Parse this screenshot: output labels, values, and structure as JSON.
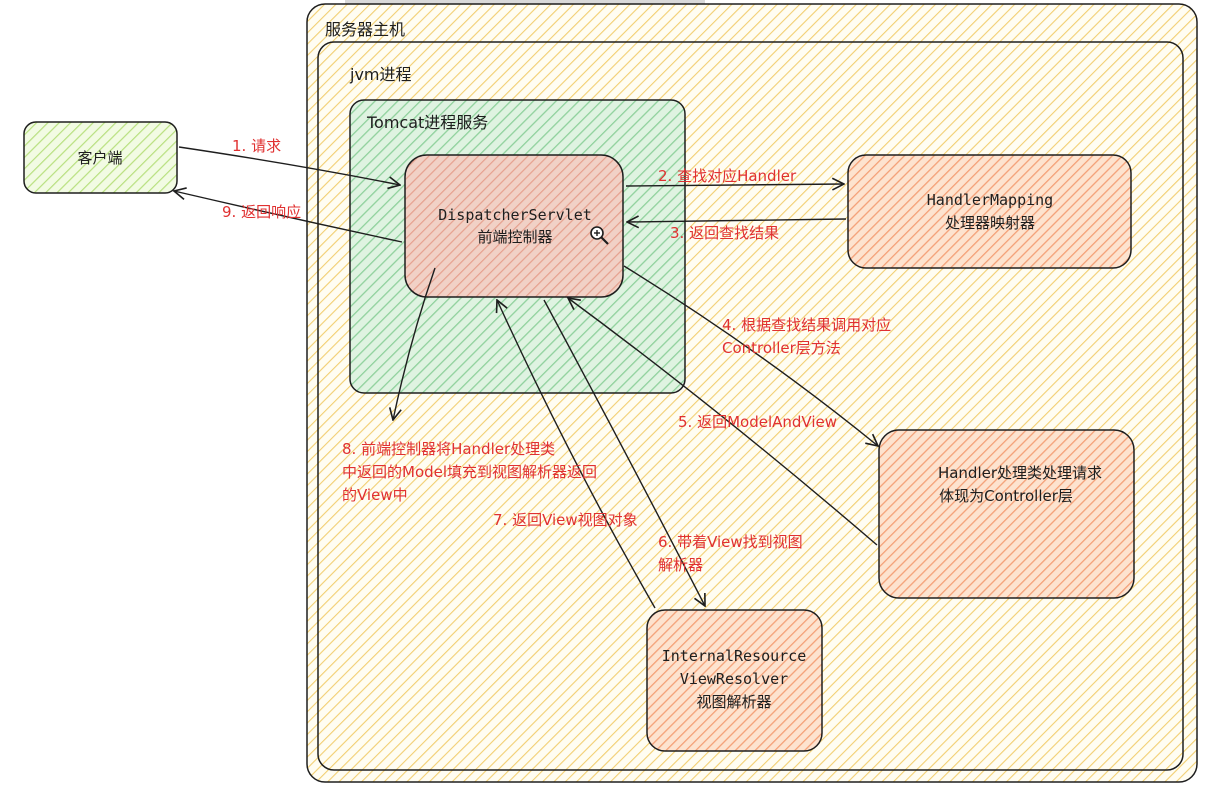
{
  "containers": {
    "server_host": "服务器主机",
    "jvm_process": "jvm进程",
    "tomcat_service": "Tomcat进程服务"
  },
  "nodes": {
    "client": "客户端",
    "dispatcher_line1": "DispatcherServlet",
    "dispatcher_line2": "前端控制器",
    "handler_mapping_line1": "HandlerMapping",
    "handler_mapping_line2": "处理器映射器",
    "handler_line1": "Handler处理类处理请求",
    "handler_line2": "体现为Controller层",
    "view_resolver_line1": "InternalResource",
    "view_resolver_line2": "ViewResolver",
    "view_resolver_line3": "视图解析器"
  },
  "steps": {
    "s1": "1. 请求",
    "s2": "2. 查找对应Handler",
    "s3": "3. 返回查找结果",
    "s4_line1": "4. 根据查找结果调用对应",
    "s4_line2": "Controller层方法",
    "s5": "5. 返回ModelAndView",
    "s6_line1": "6. 带着View找到视图",
    "s6_line2": "解析器",
    "s7": "7. 返回View视图对象",
    "s8_line1": "8. 前端控制器将Handler处理类",
    "s8_line2": "中返回的Model填充到视图解析器返回",
    "s8_line3": "的View中",
    "s9": "9. 返回响应"
  },
  "colors": {
    "server_fill": "#fff3bf",
    "tomcat_fill": "#b2f2bb",
    "client_fill": "#d8f5a2",
    "dispatcher_fill": "#ffc9c9",
    "orange_fill": "#ffc078",
    "label": "#e03131",
    "stroke": "#1e1e1e"
  }
}
